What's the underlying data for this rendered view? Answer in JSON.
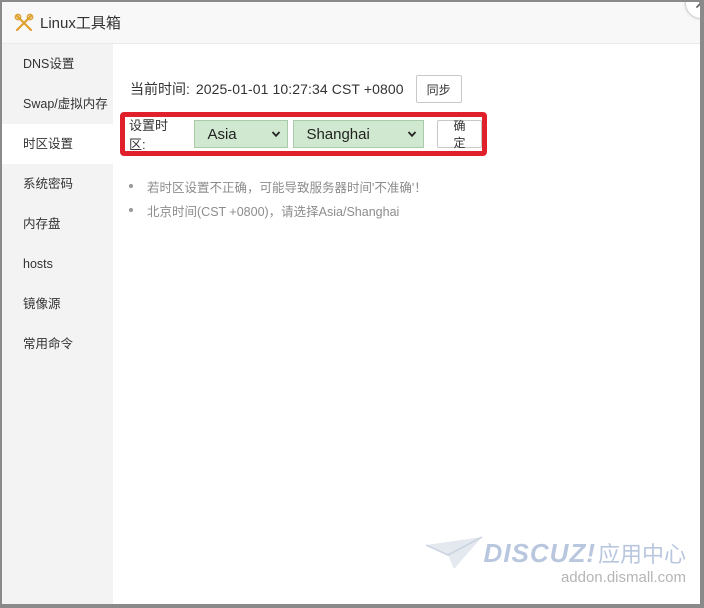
{
  "window": {
    "title": "Linux工具箱",
    "icon": "tools-icon",
    "close_icon": "close-icon"
  },
  "sidebar": {
    "items": [
      {
        "label": "DNS设置",
        "active": false
      },
      {
        "label": "Swap/虚拟内存",
        "active": false
      },
      {
        "label": "时区设置",
        "active": true
      },
      {
        "label": "系统密码",
        "active": false
      },
      {
        "label": "内存盘",
        "active": false
      },
      {
        "label": "hosts",
        "active": false
      },
      {
        "label": "镜像源",
        "active": false
      },
      {
        "label": "常用命令",
        "active": false
      }
    ]
  },
  "main": {
    "current_time_label": "当前时间:",
    "current_time_value": "2025-01-01 10:27:34 CST +0800",
    "sync_button": "同步",
    "timezone_label": "设置时区:",
    "region_select": {
      "value": "Asia"
    },
    "city_select": {
      "value": "Shanghai"
    },
    "confirm_button": "确定",
    "highlight_color": "#e0202a",
    "select_bg": "#cfe8cf",
    "tips": [
      "若时区设置不正确，可能导致服务器时间'不准确'！",
      "北京时间(CST +0800)，请选择Asia/Shanghai"
    ]
  },
  "watermark": {
    "brand": "DISCUZ!",
    "suffix": "应用中心",
    "url": "addon.dismall.com"
  }
}
